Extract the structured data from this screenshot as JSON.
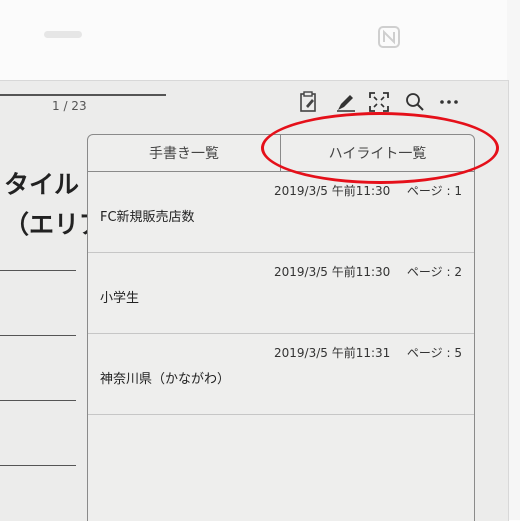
{
  "reader": {
    "page_indicator": "1 / 23",
    "heading_lines": [
      "タイル",
      "（エリア"
    ]
  },
  "toolbar": {
    "icons": [
      "note-list-icon",
      "pen-icon",
      "fit-screen-icon",
      "search-icon",
      "more-icon"
    ]
  },
  "panel": {
    "tabs": [
      {
        "label": "手書き一覧"
      },
      {
        "label": "ハイライト一覧"
      }
    ],
    "entries": [
      {
        "date": "2019/3/5 午前11:30",
        "page": "ページ : 1",
        "text": "FC新規販売店数"
      },
      {
        "date": "2019/3/5 午前11:30",
        "page": "ページ : 2",
        "text": "小学生"
      },
      {
        "date": "2019/3/5 午前11:31",
        "page": "ページ : 5",
        "text": "神奈川県（かながわ）"
      }
    ]
  },
  "colors": {
    "highlight_ring": "#e5101a",
    "screen_bg": "#ececeb"
  }
}
